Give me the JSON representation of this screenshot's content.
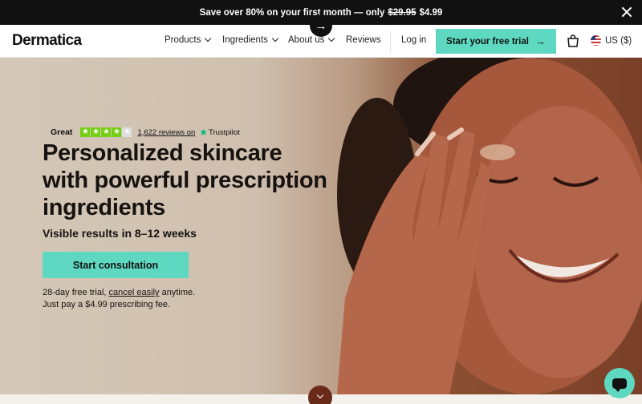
{
  "promo": {
    "text": "Save over 80% on your first month — only",
    "old_price": "$29.95",
    "new_price": "$4.99"
  },
  "header": {
    "logo": "Dermatica",
    "nav": [
      {
        "label": "Products"
      },
      {
        "label": "Ingredients"
      },
      {
        "label": "About us"
      },
      {
        "label": "Reviews"
      }
    ],
    "login": "Log in",
    "cta": "Start your free trial",
    "locale": "US ($)"
  },
  "hero": {
    "rating_word": "Great",
    "stars_filled": 4,
    "stars_total": 5,
    "reviews_link": "1,622 reviews on",
    "trustpilot": "Trustpilot",
    "headline": "Personalized skincare with powerful prescription ingredients",
    "subhead": "Visible results in 8–12 weeks",
    "cta": "Start consultation",
    "fine_line1_a": "28-day free trial,",
    "fine_line1_link": "cancel easily",
    "fine_line1_b": "anytime.",
    "fine_line2": "Just pay a $4.99 prescribing fee."
  },
  "icons": [
    "close-icon",
    "arrow-right-icon",
    "chevron-down-icon",
    "cart-icon",
    "us-flag-icon",
    "trustpilot-star-icon",
    "chat-icon"
  ],
  "colors": {
    "accent": "#5ed8c0",
    "banner": "#111111",
    "stars": "#73cf11",
    "trustpilot": "#00b67a"
  }
}
